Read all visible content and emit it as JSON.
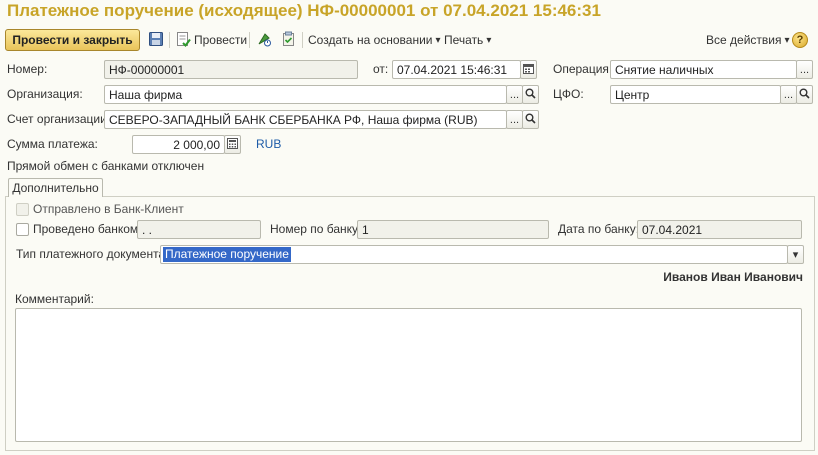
{
  "window": {
    "title": "Платежное поручение (исходящее) НФ-00000001 от 07.04.2021 15:46:31"
  },
  "toolbar": {
    "post_close_label": "Провести и закрыть",
    "post_label": "Провести",
    "create_based_label": "Создать на основании",
    "print_label": "Печать",
    "all_actions_label": "Все действия",
    "help_glyph": "?",
    "dropdown_glyph": "▾"
  },
  "form": {
    "number_label": "Номер:",
    "number_value": "НФ-00000001",
    "date_label": "от:",
    "date_value": "07.04.2021 15:46:31",
    "operation_label": "Операция:",
    "operation_value": "Снятие наличных",
    "org_label": "Организация:",
    "org_value": "Наша фирма",
    "cfo_label": "ЦФО:",
    "cfo_value": "Центр",
    "account_label": "Счет организации:",
    "account_value": "СЕВЕРО-ЗАПАДНЫЙ БАНК СБЕРБАНКА РФ, Наша фирма (RUB)",
    "sum_label": "Сумма платежа:",
    "sum_value": "2 000,00",
    "currency": "RUB",
    "bank_exchange_note": "Прямой обмен с банками отключен",
    "ellipsis_glyph": "...",
    "search_glyph": "🔍"
  },
  "tabs": [
    {
      "label": "Дополнительно"
    }
  ],
  "additional": {
    "sent_label": "Отправлено в Банк-Клиент",
    "processed_label": "Проведено банком",
    "processed_date_value": " . .",
    "bank_number_label": "Номер по банку:",
    "bank_number_value": "1",
    "bank_date_label": "Дата по банку:",
    "bank_date_value": "07.04.2021",
    "doc_type_label": "Тип платежного документа:",
    "doc_type_value": "Платежное поручение",
    "responsible": "Иванов Иван Иванович",
    "comment_label": "Комментарий:"
  }
}
